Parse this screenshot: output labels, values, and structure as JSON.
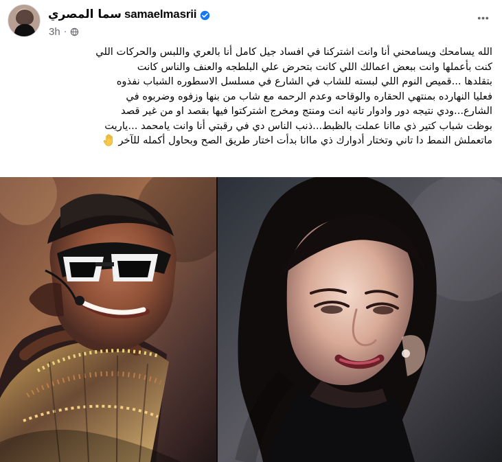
{
  "post": {
    "author": {
      "display_name": "سما المصري",
      "username": "samaelmasrii",
      "verified": true
    },
    "meta": {
      "time": "3h",
      "separator": "·",
      "audience_icon": "globe-icon"
    },
    "menu_icon": "more-horizontal-icon",
    "text_lines": [
      "الله يسامحك ويسامحني أنا وانت اشتركنا في افساد جيل كامل أنا بالعري واللبس والحركات اللي",
      "كنت بأعملها وانت ببعض اعمالك اللي كانت بتحرض علي البلطجه والعنف والناس كانت",
      "بتقلدها ...قميص النوم اللي لبسته للشاب في الشارع في مسلسل الاسطوره الشباب نفذوه",
      "فعليا النهارده بمنتهي الحقاره والوقاحه وعدم الرحمه مع شاب من بنها وزفوه وضربوه في",
      "الشارع...ودي نتيجه دور وادوار تانيه انت ومنتج ومخرج اشتركتوا فيها بقصد او من غير قصد",
      "بوظت شباب كتير ذي ماانا عملت بالظبط...ذنب الناس دي في رقبتي أنا وانت يامحمد ...ياريت",
      "ماتعملش النمط دا تاني وتختار أدوارك ذي ماانا بدأت اختار طريق الصح وبحاول أكمله للآخر"
    ],
    "trailing_emoji": "raised-hand-icon",
    "photo": {
      "description_icon": "photo-collage",
      "left_panel_icon": "performer-photo",
      "right_panel_icon": "portrait-photo"
    }
  }
}
